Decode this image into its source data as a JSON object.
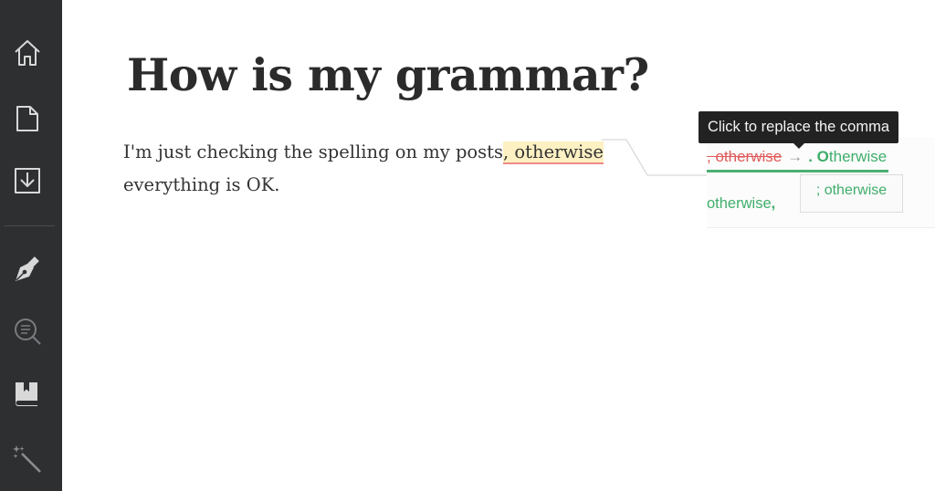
{
  "sidebar": {
    "items": [
      {
        "name": "home-icon"
      },
      {
        "name": "document-icon"
      },
      {
        "name": "download-icon"
      },
      {
        "name": "pen-nib-icon"
      },
      {
        "name": "search-text-icon"
      },
      {
        "name": "book-icon"
      },
      {
        "name": "magic-wand-icon"
      }
    ],
    "background": "#2d2f31"
  },
  "editor": {
    "title": "How is my grammar?",
    "text_before": "I'm just checking the spelling on my posts",
    "flagged_text": ", otherwise",
    "text_after": "everything is OK."
  },
  "suggestions": {
    "tooltip": "Click to replace the comma",
    "original": ", otherwise",
    "arrow": "→",
    "replacement_punct": ". ",
    "replacement_cap": "O",
    "replacement_rest": "therwise",
    "alt_semicolon": "; otherwise",
    "alt_word": "otherwise",
    "alt_comma": ","
  },
  "colors": {
    "error": "#e05a5a",
    "fix": "#3fae6a",
    "highlight": "#fdf0c2"
  }
}
